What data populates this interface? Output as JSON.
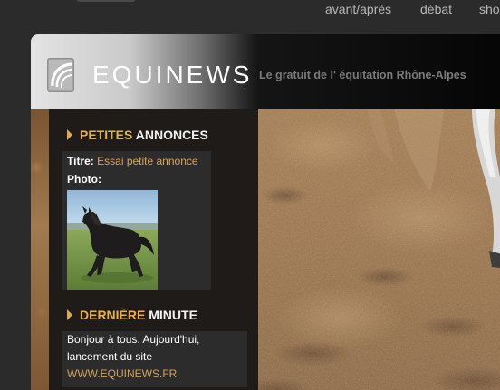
{
  "top_nav": {
    "items": [
      "avant/après",
      "débat",
      "sho"
    ]
  },
  "header": {
    "logo_text": "EQUINEWS",
    "tagline": "Le gratuit de l' équitation Rhône-Alpes"
  },
  "petites_annonces": {
    "title_accent": "PETITES",
    "title_rest": "ANNONCES",
    "titre_label": "Titre:",
    "titre_value": "Essai petite annonce",
    "photo_label": "Photo:"
  },
  "derniere_minute": {
    "title_accent": "DERNIÈRE",
    "title_rest": "MINUTE",
    "line1": "Bonjour à tous. Aujourd'hui,",
    "line2": "lancement du site",
    "link": "WWW.EQUINEWS.FR"
  },
  "colors": {
    "accent": "#e9b04a",
    "link": "#d9a55a",
    "background": "#2b2b2b",
    "sidebar": "#1e1b18"
  }
}
